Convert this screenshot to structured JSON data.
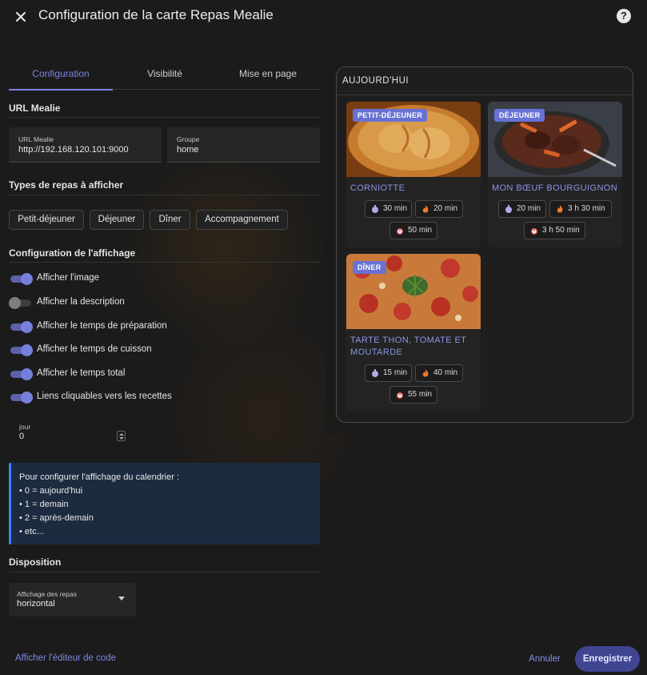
{
  "dialog": {
    "title": "Configuration de la carte Repas Mealie",
    "help_label": "?"
  },
  "tabs": [
    {
      "label": "Configuration",
      "active": true
    },
    {
      "label": "Visibilité",
      "active": false
    },
    {
      "label": "Mise en page",
      "active": false
    }
  ],
  "url_section": {
    "title": "URL Mealie",
    "url_field": {
      "label": "URL Mealie",
      "value": "http://192.168.120.101:9000"
    },
    "group_field": {
      "label": "Groupe",
      "value": "home"
    }
  },
  "meal_types": {
    "title": "Types de repas à afficher",
    "chips": [
      "Petit-déjeuner",
      "Déjeuner",
      "Dîner",
      "Accompagnement"
    ]
  },
  "display": {
    "title": "Configuration de l'affichage",
    "toggles": [
      {
        "label": "Afficher l'image",
        "on": true
      },
      {
        "label": "Afficher la description",
        "on": false
      },
      {
        "label": "Afficher le temps de préparation",
        "on": true
      },
      {
        "label": "Afficher le temps de cuisson",
        "on": true
      },
      {
        "label": "Afficher le temps total",
        "on": true
      },
      {
        "label": "Liens cliquables vers les recettes",
        "on": true
      }
    ],
    "day_field": {
      "label": "jour",
      "value": "0"
    }
  },
  "info": {
    "lines": [
      "Pour configurer l'affichage du calendrier :",
      "• 0 = aujourd'hui",
      "• 1 = demain",
      "• 2 = après-demain",
      "• etc..."
    ]
  },
  "layout": {
    "title": "Disposition",
    "select": {
      "label": "Affichage des repas",
      "value": "horizontal"
    }
  },
  "footer": {
    "code_editor": "Afficher l'éditeur de code",
    "cancel": "Annuler",
    "save": "Enregistrer"
  },
  "preview": {
    "title": "AUJOURD'HUI",
    "meals": [
      {
        "badge": "PETIT-DÉJEUNER",
        "name": "CORNIOTTE",
        "prep": "30 min",
        "cook": "20 min",
        "total": "50 min"
      },
      {
        "badge": "DÉJEUNER",
        "name": "MON BŒUF BOURGUIGNON",
        "prep": "20 min",
        "cook": "3 h 30 min",
        "total": "3 h 50 min"
      },
      {
        "badge": "DÎNER",
        "name": "TARTE THON, TOMATE ET MOUTARDE",
        "prep": "15 min",
        "cook": "40 min",
        "total": "55 min"
      }
    ],
    "colors": {
      "accent": "#6872d4",
      "link": "#8b95e4"
    }
  }
}
